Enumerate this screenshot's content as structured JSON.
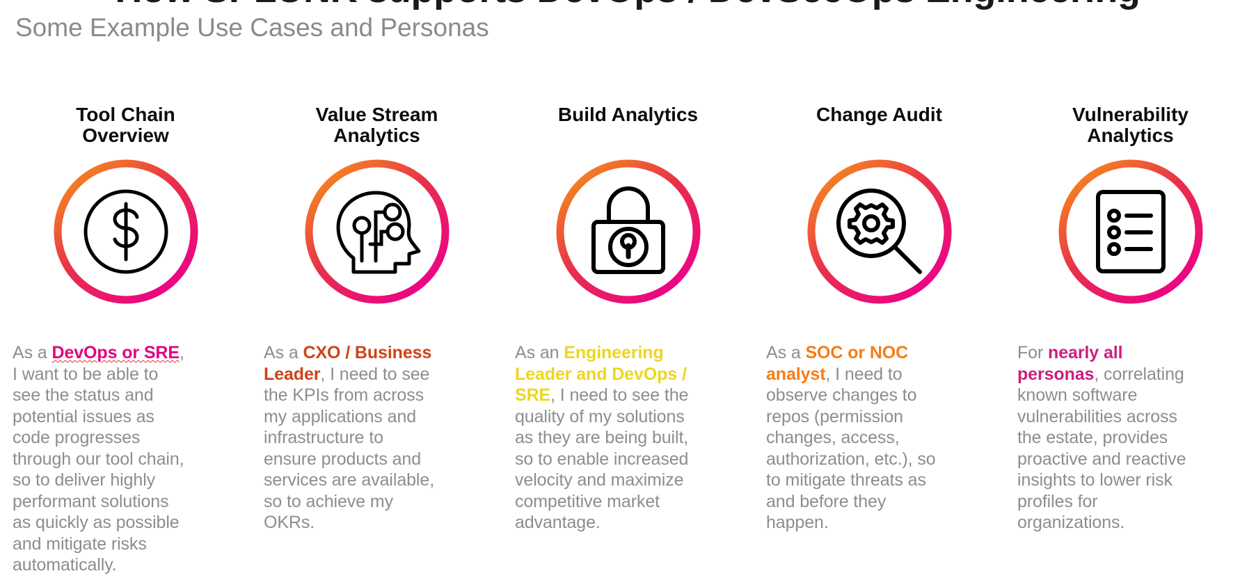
{
  "header": {
    "title": "How SPLUNK supports DevOps / DevSecOps Engineering",
    "subtitle": "Some Example Use Cases and Personas"
  },
  "colors": {
    "gradient_start": "#F5871F",
    "gradient_mid": "#E8304A",
    "gradient_end": "#EC008C",
    "body_text": "#8D8D8D",
    "heading_text": "#0D0D0D",
    "subtitle_text": "#8A8A8A",
    "accent_magenta": "#E3007F",
    "accent_orange_dark": "#CF4317",
    "accent_yellow": "#EDD621",
    "accent_orange": "#F57C16",
    "accent_pink": "#CC1F7E"
  },
  "columns": [
    {
      "heading_line1": "Tool Chain",
      "heading_line2": "Overview",
      "icon": "dollar-sign-circle-icon",
      "persona": {
        "lead": "As a ",
        "role": "DevOps or SRE",
        "role_color": "#E3007F",
        "rest": ", I want to be able to see the status and potential issues as code progresses through our tool chain, so to deliver highly performant solutions as quickly as possible and mitigate risks automatically."
      }
    },
    {
      "heading_line1": "Value Stream",
      "heading_line2": "Analytics",
      "icon": "ai-head-circuit-icon",
      "persona": {
        "lead": "As a ",
        "role": "CXO / Business Leader",
        "role_color": "#CF4317",
        "rest": ", I need to see the KPIs from across my applications and infrastructure to ensure products and services are available, so to achieve my OKRs."
      }
    },
    {
      "heading_line1": "Build Analytics",
      "heading_line2": "",
      "icon": "padlock-icon",
      "persona": {
        "lead": "As an ",
        "role": "Engineering Leader and DevOps / SRE",
        "role_color": "#EDD621",
        "rest": ", I need to see the quality of my solutions as they are being built, so to enable increased velocity and maximize competitive market advantage."
      }
    },
    {
      "heading_line1": "Change Audit",
      "heading_line2": "",
      "icon": "magnifier-gear-icon",
      "persona": {
        "lead": "As a ",
        "role": "SOC or NOC analyst",
        "role_color": "#F57C16",
        "rest": ", I need to observe changes to repos (permission changes, access, authorization, etc.), so to mitigate threats as and before they happen."
      }
    },
    {
      "heading_line1": "Vulnerability",
      "heading_line2": "Analytics",
      "icon": "checklist-document-icon",
      "persona": {
        "lead": "For ",
        "role": "nearly all personas",
        "role_color": "#CC1F7E",
        "rest": ", correlating known software vulnerabilities across the estate, provides proactive and reactive insights to lower risk profiles for organizations."
      }
    }
  ]
}
